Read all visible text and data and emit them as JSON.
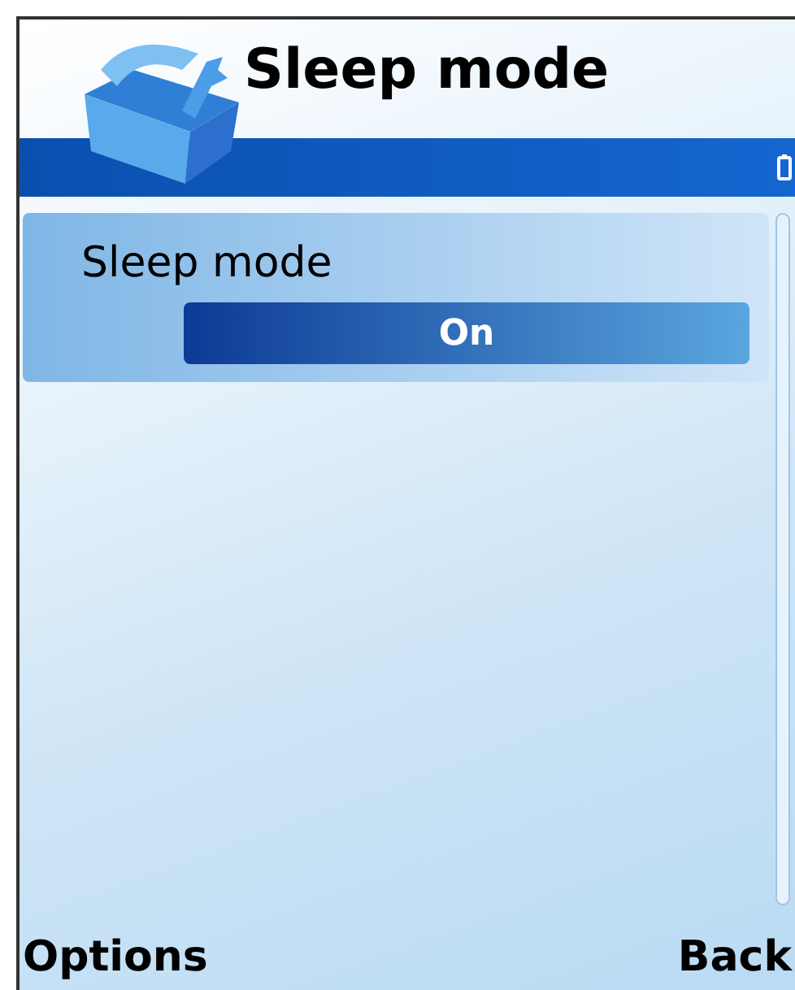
{
  "title": "Sleep mode",
  "items": [
    {
      "label": "Sleep mode",
      "value": "On",
      "selected": true
    }
  ],
  "softkeys": {
    "left": "Options",
    "right": "Back"
  }
}
